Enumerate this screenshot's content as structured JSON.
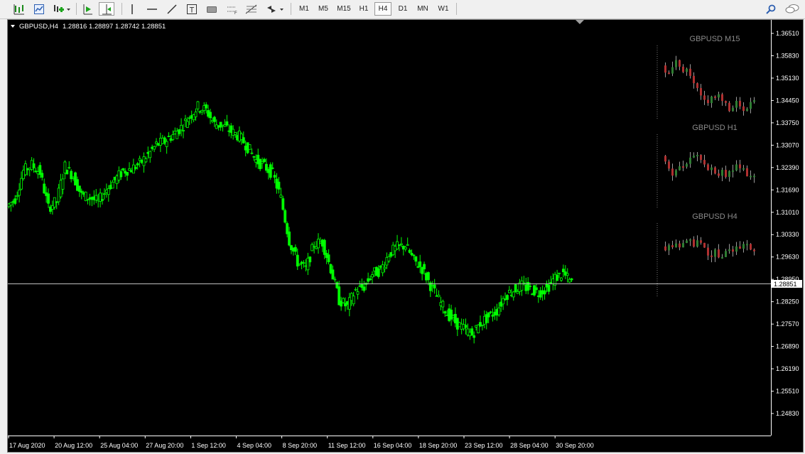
{
  "toolbar": {
    "timeframes": [
      "M1",
      "M5",
      "M15",
      "H1",
      "H4",
      "D1",
      "MN",
      "W1"
    ],
    "selected_timeframe": "H4"
  },
  "chart": {
    "symbol_header": "GBPUSD,H4",
    "ohlc": "1.28816 1.28897 1.28742 1.28851",
    "current_price": "1.28851",
    "price_labels": [
      "1.36510",
      "1.35830",
      "1.35130",
      "1.34450",
      "1.33750",
      "1.33070",
      "1.32390",
      "1.31690",
      "1.31010",
      "1.30330",
      "1.29630",
      "1.28950",
      "1.28250",
      "1.27570",
      "1.26890",
      "1.26190",
      "1.25510",
      "1.24830"
    ],
    "date_labels": [
      "17 Aug 2020",
      "20 Aug 12:00",
      "25 Aug 04:00",
      "27 Aug 20:00",
      "1 Sep 12:00",
      "4 Sep 04:00",
      "8 Sep 20:00",
      "11 Sep 12:00",
      "16 Sep 04:00",
      "18 Sep 20:00",
      "23 Sep 12:00",
      "28 Sep 04:00",
      "30 Sep 20:00"
    ],
    "mini_charts": [
      {
        "title": "GBPUSD M15"
      },
      {
        "title": "GBPUSD H1"
      },
      {
        "title": "GBPUSD H4"
      }
    ],
    "colors": {
      "background": "#000000",
      "bull": "#00ff00",
      "bid_line": "#c0c0c0",
      "axis_text": "#ffffff",
      "mini_bull": "#2e7d32",
      "mini_bear": "#b03030",
      "mini_title": "#8a8a8a"
    }
  },
  "chart_data": {
    "type": "candlestick",
    "title": "GBPUSD,H4",
    "ylim": [
      1.2483,
      1.3685
    ],
    "y": [
      1.3118,
      1.3142,
      1.3226,
      1.3244,
      1.3221,
      1.3115,
      1.3134,
      1.324,
      1.321,
      1.3152,
      1.3145,
      1.3132,
      1.317,
      1.3198,
      1.3226,
      1.3232,
      1.3248,
      1.3274,
      1.3305,
      1.3315,
      1.3335,
      1.3358,
      1.339,
      1.342,
      1.341,
      1.3368,
      1.3363,
      1.3345,
      1.333,
      1.3298,
      1.3258,
      1.324,
      1.3218,
      1.3143,
      1.3015,
      1.295,
      1.293,
      1.3005,
      1.301,
      1.293,
      1.2835,
      1.2815,
      1.2865,
      1.2875,
      1.2915,
      1.2925,
      1.2975,
      1.2995,
      1.3,
      1.2955,
      1.293,
      1.288,
      1.2835,
      1.2795,
      1.2768,
      1.2748,
      1.273,
      1.2765,
      1.2785,
      1.2803,
      1.285,
      1.2865,
      1.2878,
      1.2868,
      1.2858,
      1.287,
      1.2902,
      1.2915,
      1.2885
    ]
  }
}
